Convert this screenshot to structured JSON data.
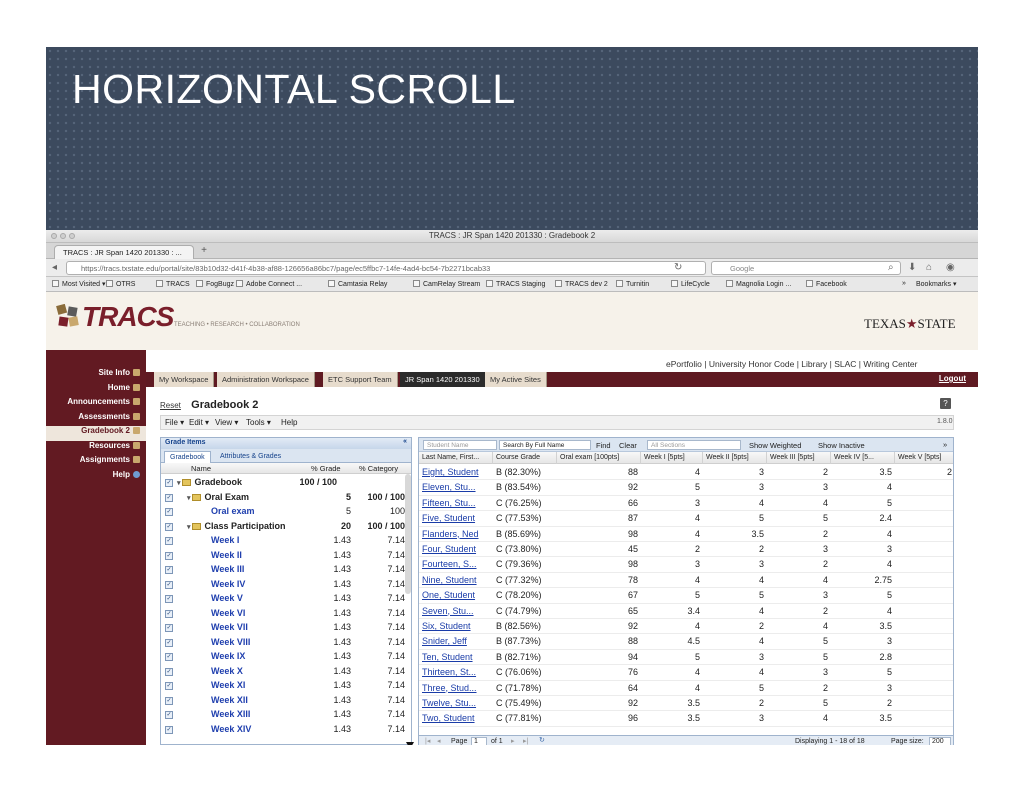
{
  "slide": {
    "title": "HORIZONTAL SCROLL"
  },
  "browser": {
    "window_title": "TRACS : JR Span 1420 201330 : Gradebook 2",
    "tab_label": "TRACS : JR Span 1420 201330 : ...",
    "new_tab": "+",
    "url": "https://tracs.txstate.edu/portal/site/83b10d32-d41f-4b38-af88-126656a86bc7/page/ec5ffbc7-14fe-4ad4-bc54-7b2271bcab33",
    "search_placeholder": "Google",
    "bookmarks": [
      "Most Visited ▾",
      "OTRS",
      "TRACS",
      "FogBugz",
      "Adobe Connect ...",
      "Camtasia Relay",
      "CamRelay Stream",
      "TRACS Staging",
      "TRACS dev 2",
      "Turnitin",
      "LifeCycle",
      "Magnolia Login ...",
      "Facebook"
    ],
    "bookmarks_menu": "Bookmarks ▾",
    "more": "»"
  },
  "banner": {
    "logo": "TRACS",
    "tagline": "TEACHING • RESEARCH • COLLABORATION",
    "university": "TEXAS",
    "university2": "STATE",
    "star": "★"
  },
  "site_nav": [
    {
      "label": "Site Info"
    },
    {
      "label": "Home"
    },
    {
      "label": "Announcements"
    },
    {
      "label": "Assessments"
    },
    {
      "label": "Gradebook 2"
    },
    {
      "label": "Resources"
    },
    {
      "label": "Assignments"
    },
    {
      "label": "Help"
    }
  ],
  "top_links": "ePortfolio | University Honor Code | Library | SLAC | Writing Center",
  "site_tabs": [
    "My Workspace",
    "Administration Workspace",
    "ETC Support Team",
    "JR Span 1420 201330",
    "My Active Sites"
  ],
  "logout": "Logout",
  "tool": {
    "reset": "Reset",
    "title": "Gradebook 2",
    "help": "?",
    "menus": [
      "File ▾",
      "Edit ▾",
      "View ▾",
      "Tools ▾",
      "Help"
    ],
    "version": "1.8.0"
  },
  "grade_items": {
    "header": "Grade Items",
    "collapse": "«",
    "tabs": [
      "Gradebook",
      "Attributes & Grades"
    ],
    "columns": [
      "Name",
      "% Grade",
      "% Category"
    ],
    "rows": [
      {
        "name": "Gradebook",
        "pts": "100 / 100",
        "pct": "",
        "style": "bold",
        "indent": 0,
        "folder": true,
        "arrow": "▸ ▾"
      },
      {
        "name": "Oral Exam",
        "pts": "5",
        "pct": "100 / 100",
        "style": "bold",
        "indent": 1,
        "folder": true,
        "arrow": "▾"
      },
      {
        "name": "Oral exam",
        "pts": "5",
        "pct": "100",
        "style": "blue",
        "indent": 2
      },
      {
        "name": "Class Participation",
        "pts": "20",
        "pct": "100 / 100",
        "style": "bold",
        "indent": 1,
        "folder": true,
        "arrow": "▾"
      },
      {
        "name": "Week I",
        "pts": "1.43",
        "pct": "7.14",
        "style": "blue",
        "indent": 2
      },
      {
        "name": "Week II",
        "pts": "1.43",
        "pct": "7.14",
        "style": "blue",
        "indent": 2
      },
      {
        "name": "Week III",
        "pts": "1.43",
        "pct": "7.14",
        "style": "blue",
        "indent": 2
      },
      {
        "name": "Week IV",
        "pts": "1.43",
        "pct": "7.14",
        "style": "blue",
        "indent": 2
      },
      {
        "name": "Week V",
        "pts": "1.43",
        "pct": "7.14",
        "style": "blue",
        "indent": 2
      },
      {
        "name": "Week VI",
        "pts": "1.43",
        "pct": "7.14",
        "style": "blue",
        "indent": 2
      },
      {
        "name": "Week VII",
        "pts": "1.43",
        "pct": "7.14",
        "style": "blue",
        "indent": 2
      },
      {
        "name": "Week VIII",
        "pts": "1.43",
        "pct": "7.14",
        "style": "blue",
        "indent": 2
      },
      {
        "name": "Week IX",
        "pts": "1.43",
        "pct": "7.14",
        "style": "blue",
        "indent": 2
      },
      {
        "name": "Week X",
        "pts": "1.43",
        "pct": "7.14",
        "style": "blue",
        "indent": 2
      },
      {
        "name": "Week XI",
        "pts": "1.43",
        "pct": "7.14",
        "style": "blue",
        "indent": 2
      },
      {
        "name": "Week XII",
        "pts": "1.43",
        "pct": "7.14",
        "style": "blue",
        "indent": 2
      },
      {
        "name": "Week XIII",
        "pts": "1.43",
        "pct": "7.14",
        "style": "blue",
        "indent": 2
      },
      {
        "name": "Week XIV",
        "pts": "1.43",
        "pct": "7.14",
        "style": "blue",
        "indent": 2
      }
    ]
  },
  "grid": {
    "student_name_placeholder": "Student Name",
    "search_by": "Search By Full Name",
    "find": "Find",
    "clear": "Clear",
    "all_sections": "All Sections",
    "show_weighted": "Show Weighted",
    "show_inactive": "Show Inactive",
    "expand": "»",
    "columns": [
      "Last Name, First...",
      "Course Grade",
      "Oral exam [100pts]",
      "Week I [5pts]",
      "Week II [5pts]",
      "Week III [5pts]",
      "Week IV [5...",
      "Week V [5pts]"
    ],
    "rows": [
      [
        "Eight, Student",
        "B (82.30%)",
        "88",
        "4",
        "3",
        "2",
        "3.5",
        "2"
      ],
      [
        "Eleven, Stu...",
        "B (83.54%)",
        "92",
        "5",
        "3",
        "3",
        "4",
        ""
      ],
      [
        "Fifteen, Stu...",
        "C (76.25%)",
        "66",
        "3",
        "4",
        "4",
        "5",
        ""
      ],
      [
        "Five, Student",
        "C (77.53%)",
        "87",
        "4",
        "5",
        "5",
        "2.4",
        ""
      ],
      [
        "Flanders, Ned",
        "B (85.69%)",
        "98",
        "4",
        "3.5",
        "2",
        "4",
        ""
      ],
      [
        "Four, Student",
        "C (73.80%)",
        "45",
        "2",
        "2",
        "3",
        "3",
        ""
      ],
      [
        "Fourteen, S...",
        "C (79.36%)",
        "98",
        "3",
        "3",
        "2",
        "4",
        ""
      ],
      [
        "Nine, Student",
        "C (77.32%)",
        "78",
        "4",
        "4",
        "4",
        "2.75",
        ""
      ],
      [
        "One, Student",
        "C (78.20%)",
        "67",
        "5",
        "5",
        "3",
        "5",
        ""
      ],
      [
        "Seven, Stu...",
        "C (74.79%)",
        "65",
        "3.4",
        "4",
        "2",
        "4",
        ""
      ],
      [
        "Six, Student",
        "B (82.56%)",
        "92",
        "4",
        "2",
        "4",
        "3.5",
        ""
      ],
      [
        "Snider, Jeff",
        "B (87.73%)",
        "88",
        "4.5",
        "4",
        "5",
        "3",
        ""
      ],
      [
        "Ten, Student",
        "B (82.71%)",
        "94",
        "5",
        "3",
        "5",
        "2.8",
        ""
      ],
      [
        "Thirteen, St...",
        "C (76.06%)",
        "76",
        "4",
        "4",
        "3",
        "5",
        ""
      ],
      [
        "Three, Stud...",
        "C (71.78%)",
        "64",
        "4",
        "5",
        "2",
        "3",
        ""
      ],
      [
        "Twelve, Stu...",
        "C (75.49%)",
        "92",
        "3.5",
        "2",
        "5",
        "2",
        ""
      ],
      [
        "Two, Student",
        "C (77.81%)",
        "96",
        "3.5",
        "3",
        "4",
        "3.5",
        ""
      ]
    ]
  },
  "pager": {
    "page_label": "Page",
    "page": "1",
    "of": "of 1",
    "displaying": "Displaying 1 - 18 of 18",
    "page_size_label": "Page size:",
    "page_size": "200"
  }
}
